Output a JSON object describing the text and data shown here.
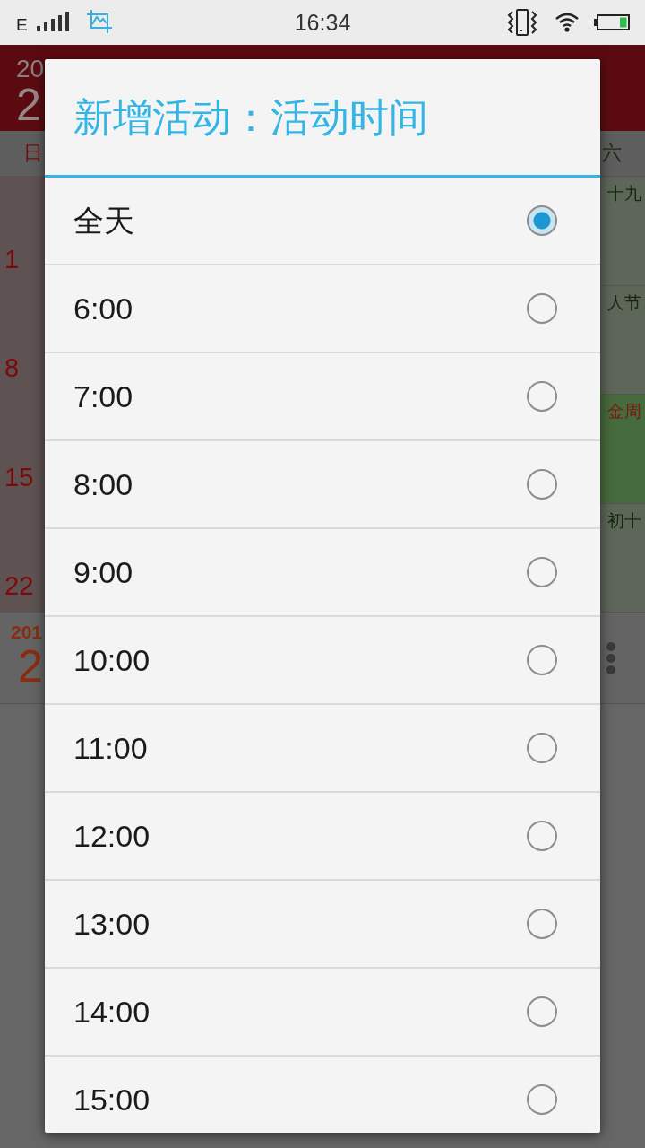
{
  "status_bar": {
    "network": "E",
    "time": "16:34"
  },
  "calendar": {
    "year": "20",
    "month": "2",
    "weekdays": [
      "日",
      "六"
    ],
    "weeks": [
      {
        "day": "1",
        "lunar": "十九",
        "highlighted": false
      },
      {
        "day": "8",
        "lunar": "人节",
        "highlighted": false
      },
      {
        "day": "15",
        "lunar": "金周",
        "highlighted": true
      },
      {
        "day": "22",
        "lunar": "初十",
        "highlighted": false
      }
    ],
    "footer": {
      "year": "201",
      "day": "2"
    }
  },
  "dialog": {
    "title": "新增活动：活动时间",
    "options": [
      {
        "label": "全天",
        "selected": true
      },
      {
        "label": "6:00",
        "selected": false
      },
      {
        "label": "7:00",
        "selected": false
      },
      {
        "label": "8:00",
        "selected": false
      },
      {
        "label": "9:00",
        "selected": false
      },
      {
        "label": "10:00",
        "selected": false
      },
      {
        "label": "11:00",
        "selected": false
      },
      {
        "label": "12:00",
        "selected": false
      },
      {
        "label": "13:00",
        "selected": false
      },
      {
        "label": "14:00",
        "selected": false
      },
      {
        "label": "15:00",
        "selected": false
      }
    ]
  }
}
